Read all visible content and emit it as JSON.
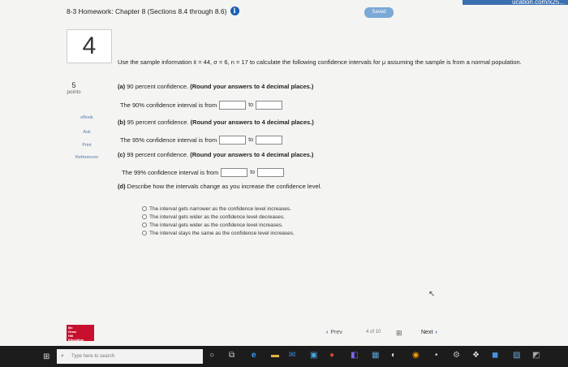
{
  "header": {
    "title": "8-3 Homework: Chapter 8 (Sections 8.4 through 8.6)",
    "info_icon": "i",
    "saved": "Saved",
    "url_fragment": "ucation.com/x25..."
  },
  "question": {
    "number": "4",
    "points_value": "5",
    "points_label": "points",
    "side_links": [
      "eBook",
      "Ask",
      "Print",
      "References"
    ],
    "prompt": "Use the sample information x̄ = 44, σ = 6, n = 17 to calculate the following confidence intervals for μ assuming the sample is from a normal population.",
    "parts": [
      {
        "label": "(a)",
        "text": "90 percent confidence.",
        "instruction": "(Round your answers to 4 decimal places.)",
        "interval_text": "The 90% confidence interval is from",
        "to": "to"
      },
      {
        "label": "(b)",
        "text": "95 percent confidence.",
        "instruction": "(Round your answers to 4 decimal places.)",
        "interval_text": "The 95% confidence interval is from",
        "to": "to"
      },
      {
        "label": "(c)",
        "text": "99 percent confidence.",
        "instruction": "(Round your answers to 4 decimal places.)",
        "interval_text": "The 99% confidence interval is from",
        "to": "to"
      }
    ],
    "part_d": {
      "label": "(d)",
      "text": "Describe how the intervals change as you increase the confidence level."
    },
    "options": [
      "The interval gets narrower as the confidence level increases.",
      "The interval gets wider as the confidence level decreases.",
      "The interval gets wider as the confidence level increases.",
      "The interval stays the same as the confidence level increases."
    ]
  },
  "navigation": {
    "prev": "Prev",
    "page": "4",
    "of": "of",
    "total": "10",
    "next": "Next"
  },
  "logo": {
    "lines": [
      "Mc",
      "Graw",
      "Hill",
      "Education"
    ]
  },
  "taskbar": {
    "search_placeholder": "Type here to search"
  }
}
